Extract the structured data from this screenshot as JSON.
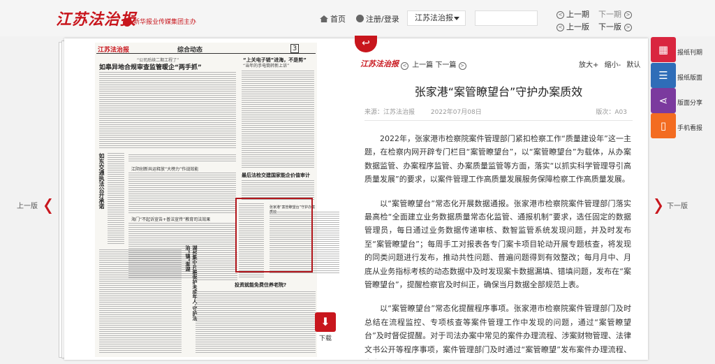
{
  "header": {
    "logo": "江苏法治报",
    "sub_logo": "新华报业传媒集团主办",
    "home": "首页",
    "login": "注册/登录",
    "paper_select": "江苏法治报",
    "prev_issue": "上一期",
    "next_issue": "下一期",
    "prev_edition": "上一版",
    "next_edition": "下一版"
  },
  "sides": {
    "prev": "上一版",
    "next": "下一版"
  },
  "newspaper": {
    "masthead": "江苏法治报",
    "section": "综合动态",
    "page_no": "3",
    "kicker": "“公司后续二期工程了”",
    "lead_head": "如皋异地合规审查监管暖企“两手抓”",
    "head2": "“上关电子销”进海，不是剪”",
    "head2b": "“当年的手电筒转新上诉”",
    "mid_head": "最后法检交建国家能企价值审计",
    "v_head": "如东交通执法公开承诺",
    "sub1": "江阴创新共运释放“大榜力”作战效能",
    "sub2": "海门“不起诉宣告+普法宣传”教育司法效果",
    "hl_title": "张家港“案管瞭望台”守护办案质效",
    "v_head2": "湖州集中开展保护未成年人·守护法治“镇”澎湖",
    "bottom_head": "投资就能免费住养老院?"
  },
  "article": {
    "return_icon": "return-arrow-icon",
    "logo": "江苏法治报",
    "prev": "上一篇",
    "next": "下一篇",
    "zoom_in": "放大+",
    "zoom_out": "缩小-",
    "reset": "默认",
    "title": "张家港“案管瞭望台”守护办案质效",
    "source": "来源：江苏法治报",
    "date": "2022年07月08日",
    "edition": "版次：A03",
    "paragraphs": [
      "2022年，张家港市检察院案件管理部门紧扣检察工作“质量建设年”这一主题，在检察内网开辟专门栏目“案管瞭望台”，以“案管瞭望台”为载体，从办案数据监管、办案程序监管、办案质量监管等方面，落实“以抓实科学管理导引高质量发展”的要求，以案件管理工作高质量发展服务保障检察工作高质量发展。",
      "以“案管瞭望台”常态化开展数据通报。张家港市检察院案件管理部门落实最高检“全面建立业务数据质量常态化监管、通报机制”要求，选任固定的数据管理员，每日通过业务数据传递审核、数智监管系统发现问题，并及时发布至“案管瞭望台”；每周手工对报表各专门案卡项目轮动开展专题核查，将发现的同类问题进行发布，推动共性问题、普遍问题得到有效整改；每月月中、月底从业务指标考核的动态数据中及时发现案卡数据漏填、错填问题，发布在“案管瞭望台”，提醒检察官及时纠正，确保当月数据全部规范上表。",
      "以“案管瞭望台”常态化提醒程序事项。张家港市检察院案件管理部门及时总结在流程监控、专项核查等案件管理工作中发现的问题，通过“案管瞭望台”及时督促提醒。对于司法办案中常见的案件办理流程、涉案财物管理、法律文书公开等程序事项，案件管理部门及时通过“案管瞭望”发布案件办理流程、案卡项目补录"
    ]
  },
  "download": {
    "label": "下载",
    "icon": "pdf-icon"
  },
  "sidebar": {
    "items": [
      {
        "label": "报纸刊期",
        "icon": "calendar-icon",
        "color": "#d9263f"
      },
      {
        "label": "报纸版面",
        "icon": "list-icon",
        "color": "#2f6db8"
      },
      {
        "label": "版面分享",
        "icon": "share-icon",
        "color": "#7b3a9e"
      },
      {
        "label": "手机看报",
        "icon": "mobile-icon",
        "color": "#f36c21"
      }
    ]
  },
  "colors": {
    "brand_red": "#c8161d"
  }
}
